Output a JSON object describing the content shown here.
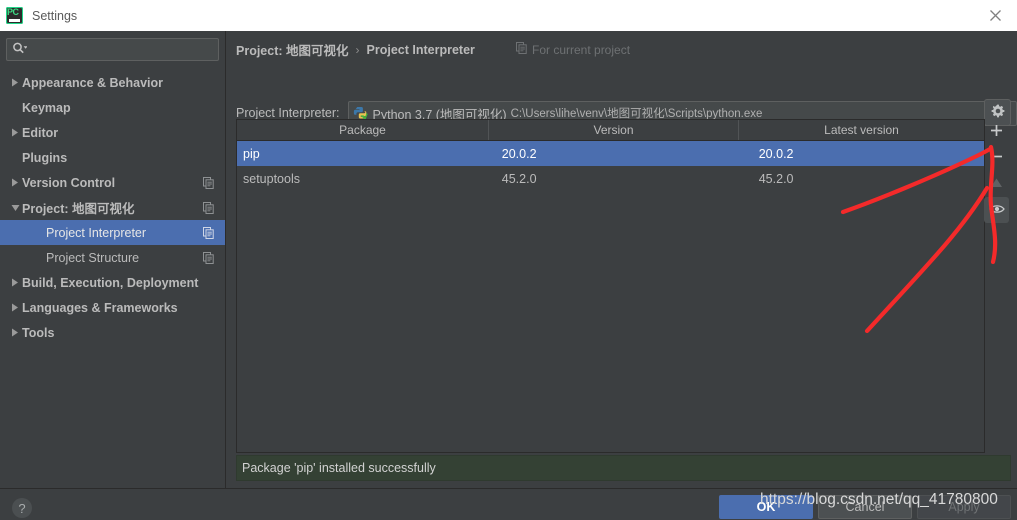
{
  "window": {
    "title": "Settings",
    "app_icon": "pycharm-logo-icon",
    "close_icon": "close-icon"
  },
  "sidebar": {
    "search": {
      "value": "",
      "placeholder": "",
      "icon": "search-icon"
    },
    "items": [
      {
        "label": "Appearance & Behavior",
        "expandable": true,
        "expanded": false,
        "indent": 0,
        "scope_icon": false,
        "selected": false
      },
      {
        "label": "Keymap",
        "expandable": false,
        "expanded": false,
        "indent": 0,
        "scope_icon": false,
        "selected": false
      },
      {
        "label": "Editor",
        "expandable": true,
        "expanded": false,
        "indent": 0,
        "scope_icon": false,
        "selected": false
      },
      {
        "label": "Plugins",
        "expandable": false,
        "expanded": false,
        "indent": 0,
        "scope_icon": false,
        "selected": false
      },
      {
        "label": "Version Control",
        "expandable": true,
        "expanded": false,
        "indent": 0,
        "scope_icon": true,
        "selected": false
      },
      {
        "label": "Project: 地图可视化",
        "expandable": true,
        "expanded": true,
        "indent": 0,
        "scope_icon": true,
        "selected": false
      },
      {
        "label": "Project Interpreter",
        "expandable": false,
        "expanded": false,
        "indent": 1,
        "scope_icon": true,
        "selected": true
      },
      {
        "label": "Project Structure",
        "expandable": false,
        "expanded": false,
        "indent": 1,
        "scope_icon": true,
        "selected": false
      },
      {
        "label": "Build, Execution, Deployment",
        "expandable": true,
        "expanded": false,
        "indent": 0,
        "scope_icon": false,
        "selected": false
      },
      {
        "label": "Languages & Frameworks",
        "expandable": true,
        "expanded": false,
        "indent": 0,
        "scope_icon": false,
        "selected": false
      },
      {
        "label": "Tools",
        "expandable": true,
        "expanded": false,
        "indent": 0,
        "scope_icon": false,
        "selected": false
      }
    ]
  },
  "main": {
    "breadcrumb": {
      "project": "Project: 地图可视化",
      "separator": "›",
      "page": "Project Interpreter"
    },
    "scope_note": {
      "icon": "project-scope-icon",
      "text": "For current project"
    },
    "interpreter": {
      "label": "Project Interpreter:",
      "icon": "python-venv-icon",
      "name": "Python 3.7 (地图可视化)",
      "path": "C:\\Users\\lihe\\venv\\地图可视化\\Scripts\\python.exe",
      "caret_icon": "chevron-down-icon",
      "settings_icon": "gear-icon"
    },
    "packages_table": {
      "columns": [
        "Package",
        "Version",
        "Latest version"
      ],
      "rows": [
        {
          "package": "pip",
          "version": "20.0.2",
          "latest": "20.0.2",
          "selected": true
        },
        {
          "package": "setuptools",
          "version": "45.2.0",
          "latest": "45.2.0",
          "selected": false
        }
      ]
    },
    "table_toolbar": [
      {
        "name": "add-package-button",
        "icon": "plus-icon",
        "state": "enabled"
      },
      {
        "name": "remove-package-button",
        "icon": "minus-icon",
        "state": "enabled"
      },
      {
        "name": "upgrade-package-button",
        "icon": "upgrade-arrow-icon",
        "state": "disabled"
      },
      {
        "name": "show-early-releases-button",
        "icon": "eye-icon",
        "state": "hover"
      }
    ],
    "status": {
      "message": "Package 'pip' installed successfully",
      "background": "#344134"
    }
  },
  "footer": {
    "help_icon": "help-icon",
    "buttons": [
      {
        "label": "OK",
        "style": "default"
      },
      {
        "label": "Cancel",
        "style": "normal"
      },
      {
        "label": "Apply",
        "style": "disabled"
      }
    ]
  },
  "overlay": {
    "watermark": "https://blog.csdn.net/qq_41780800",
    "annotation_color": "#f42a2a",
    "annotation_note": "hand-drawn red arrows pointing to the add-package (+) button"
  },
  "colors": {
    "selection": "#4b6eaf",
    "panel": "#3c3f41",
    "border": "#2b2b2b",
    "field": "#45494a",
    "text": "#bbbbbb",
    "status_green": "#344134",
    "annotation_red": "#f42a2a"
  }
}
